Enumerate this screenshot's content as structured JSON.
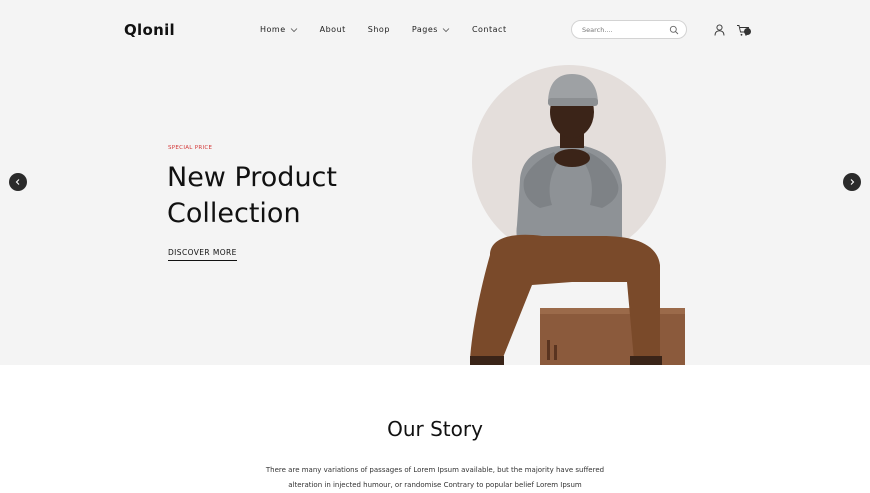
{
  "header": {
    "logo": "Qlonil",
    "nav": [
      {
        "label": "Home",
        "has_dropdown": true
      },
      {
        "label": "About",
        "has_dropdown": false
      },
      {
        "label": "Shop",
        "has_dropdown": false
      },
      {
        "label": "Pages",
        "has_dropdown": true
      },
      {
        "label": "Contact",
        "has_dropdown": false
      }
    ],
    "search": {
      "placeholder": "Search....",
      "value": ""
    },
    "icons": {
      "search": "search-icon",
      "user": "user-icon",
      "cart": "cart-icon"
    }
  },
  "hero": {
    "eyebrow": "SPECIAL PRICE",
    "title_line1": "New Product",
    "title_line2": "Collection",
    "cta": "DISCOVER MORE",
    "prev_icon": "chevron-left-icon",
    "next_icon": "chevron-right-icon"
  },
  "story": {
    "title": "Our Story",
    "text_line1": "There are many variations of passages of Lorem Ipsum available, but the majority have suffered",
    "text_line2": "alteration in injected humour, or randomise Contrary to popular belief Lorem Ipsum"
  },
  "colors": {
    "hero_bg": "#f4f4f4",
    "accent_red": "#d33838",
    "arrow_bg": "#2b2b2b",
    "circle": "#e4dedb",
    "sweater": "#8e9296",
    "pants": "#7a4a2a",
    "box": "#8b5a3c"
  }
}
